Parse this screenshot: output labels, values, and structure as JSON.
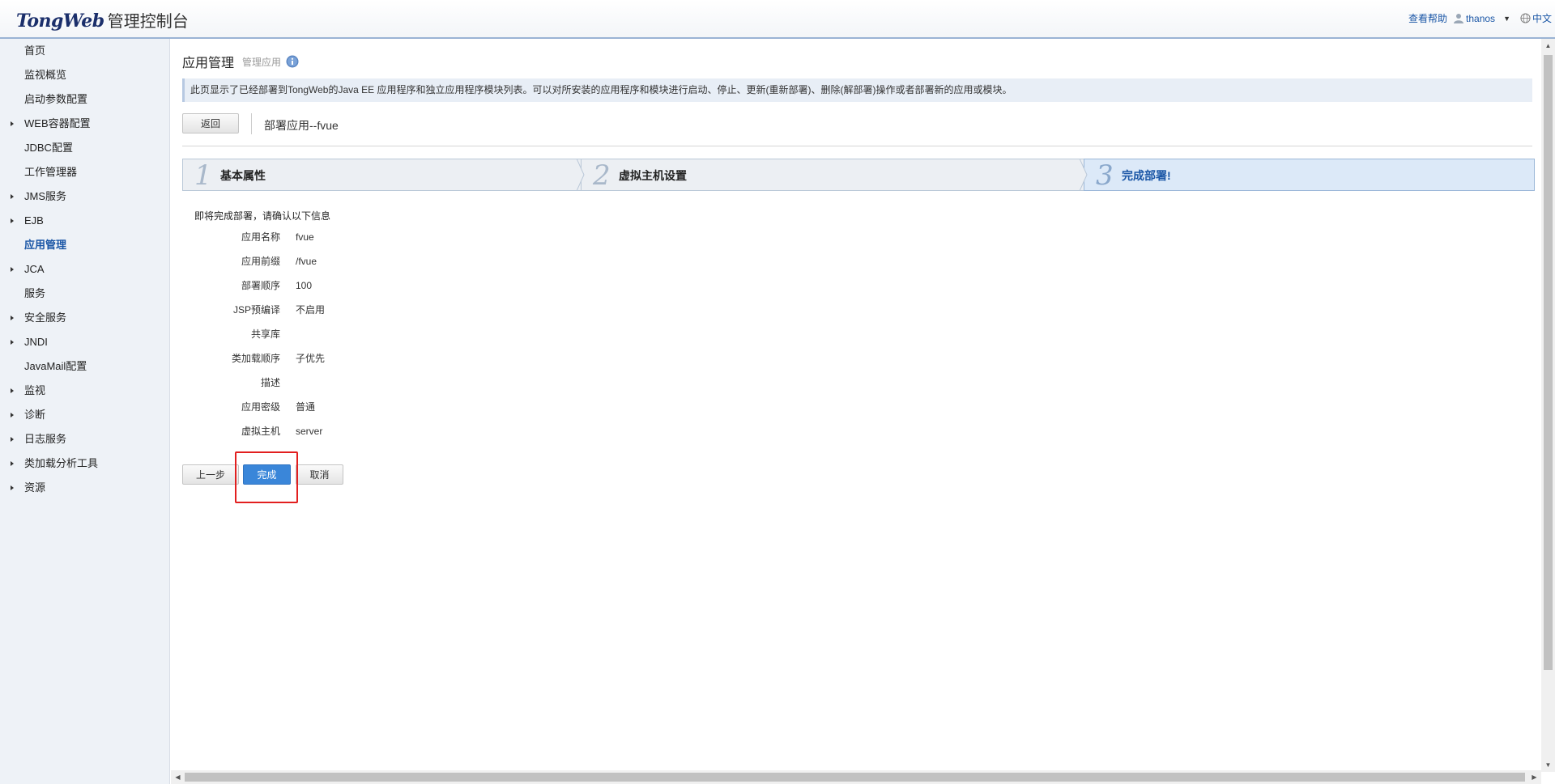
{
  "header": {
    "logo_mark": "TongWeb",
    "title": "管理控制台",
    "help": "查看帮助",
    "user": "thanos",
    "lang": "中文"
  },
  "sidebar": {
    "items": [
      {
        "label": "首页",
        "expandable": false,
        "active": false
      },
      {
        "label": "监视概览",
        "expandable": false,
        "active": false
      },
      {
        "label": "启动参数配置",
        "expandable": false,
        "active": false
      },
      {
        "label": "WEB容器配置",
        "expandable": true,
        "active": false
      },
      {
        "label": "JDBC配置",
        "expandable": false,
        "active": false
      },
      {
        "label": "工作管理器",
        "expandable": false,
        "active": false
      },
      {
        "label": "JMS服务",
        "expandable": true,
        "active": false
      },
      {
        "label": "EJB",
        "expandable": true,
        "active": false
      },
      {
        "label": "应用管理",
        "expandable": false,
        "active": true
      },
      {
        "label": "JCA",
        "expandable": true,
        "active": false
      },
      {
        "label": "服务",
        "expandable": false,
        "active": false
      },
      {
        "label": "安全服务",
        "expandable": true,
        "active": false
      },
      {
        "label": "JNDI",
        "expandable": true,
        "active": false
      },
      {
        "label": "JavaMail配置",
        "expandable": false,
        "active": false
      },
      {
        "label": "监视",
        "expandable": true,
        "active": false
      },
      {
        "label": "诊断",
        "expandable": true,
        "active": false
      },
      {
        "label": "日志服务",
        "expandable": true,
        "active": false
      },
      {
        "label": "类加载分析工具",
        "expandable": true,
        "active": false
      },
      {
        "label": "资源",
        "expandable": true,
        "active": false
      }
    ]
  },
  "main": {
    "title": "应用管理",
    "subtitle": "管理应用",
    "description": "此页显示了已经部署到TongWeb的Java EE 应用程序和独立应用程序模块列表。可以对所安装的应用程序和模块进行启动、停止、更新(重新部署)、删除(解部署)操作或者部署新的应用或模块。",
    "back_label": "返回",
    "deploy_title": "部署应用--fvue",
    "steps": [
      {
        "num": "1",
        "label": "基本属性"
      },
      {
        "num": "2",
        "label": "虚拟主机设置"
      },
      {
        "num": "3",
        "label": "完成部署!"
      }
    ],
    "current_step": 3,
    "confirm_text": "即将完成部署，请确认以下信息",
    "summary": [
      {
        "key": "应用名称",
        "value": "fvue"
      },
      {
        "key": "应用前缀",
        "value": "/fvue"
      },
      {
        "key": "部署顺序",
        "value": "100"
      },
      {
        "key": "JSP预编译",
        "value": "不启用"
      },
      {
        "key": "共享库",
        "value": ""
      },
      {
        "key": "类加载顺序",
        "value": "子优先"
      },
      {
        "key": "描述",
        "value": ""
      },
      {
        "key": "应用密级",
        "value": "普通"
      },
      {
        "key": "虚拟主机",
        "value": "server"
      }
    ],
    "buttons": {
      "prev": "上一步",
      "finish": "完成",
      "cancel": "取消"
    }
  },
  "colors": {
    "accent": "#1a56a6",
    "primary_button": "#3a86d9",
    "highlight": "#e21f1f",
    "sidebar_bg": "#eef2f7"
  }
}
